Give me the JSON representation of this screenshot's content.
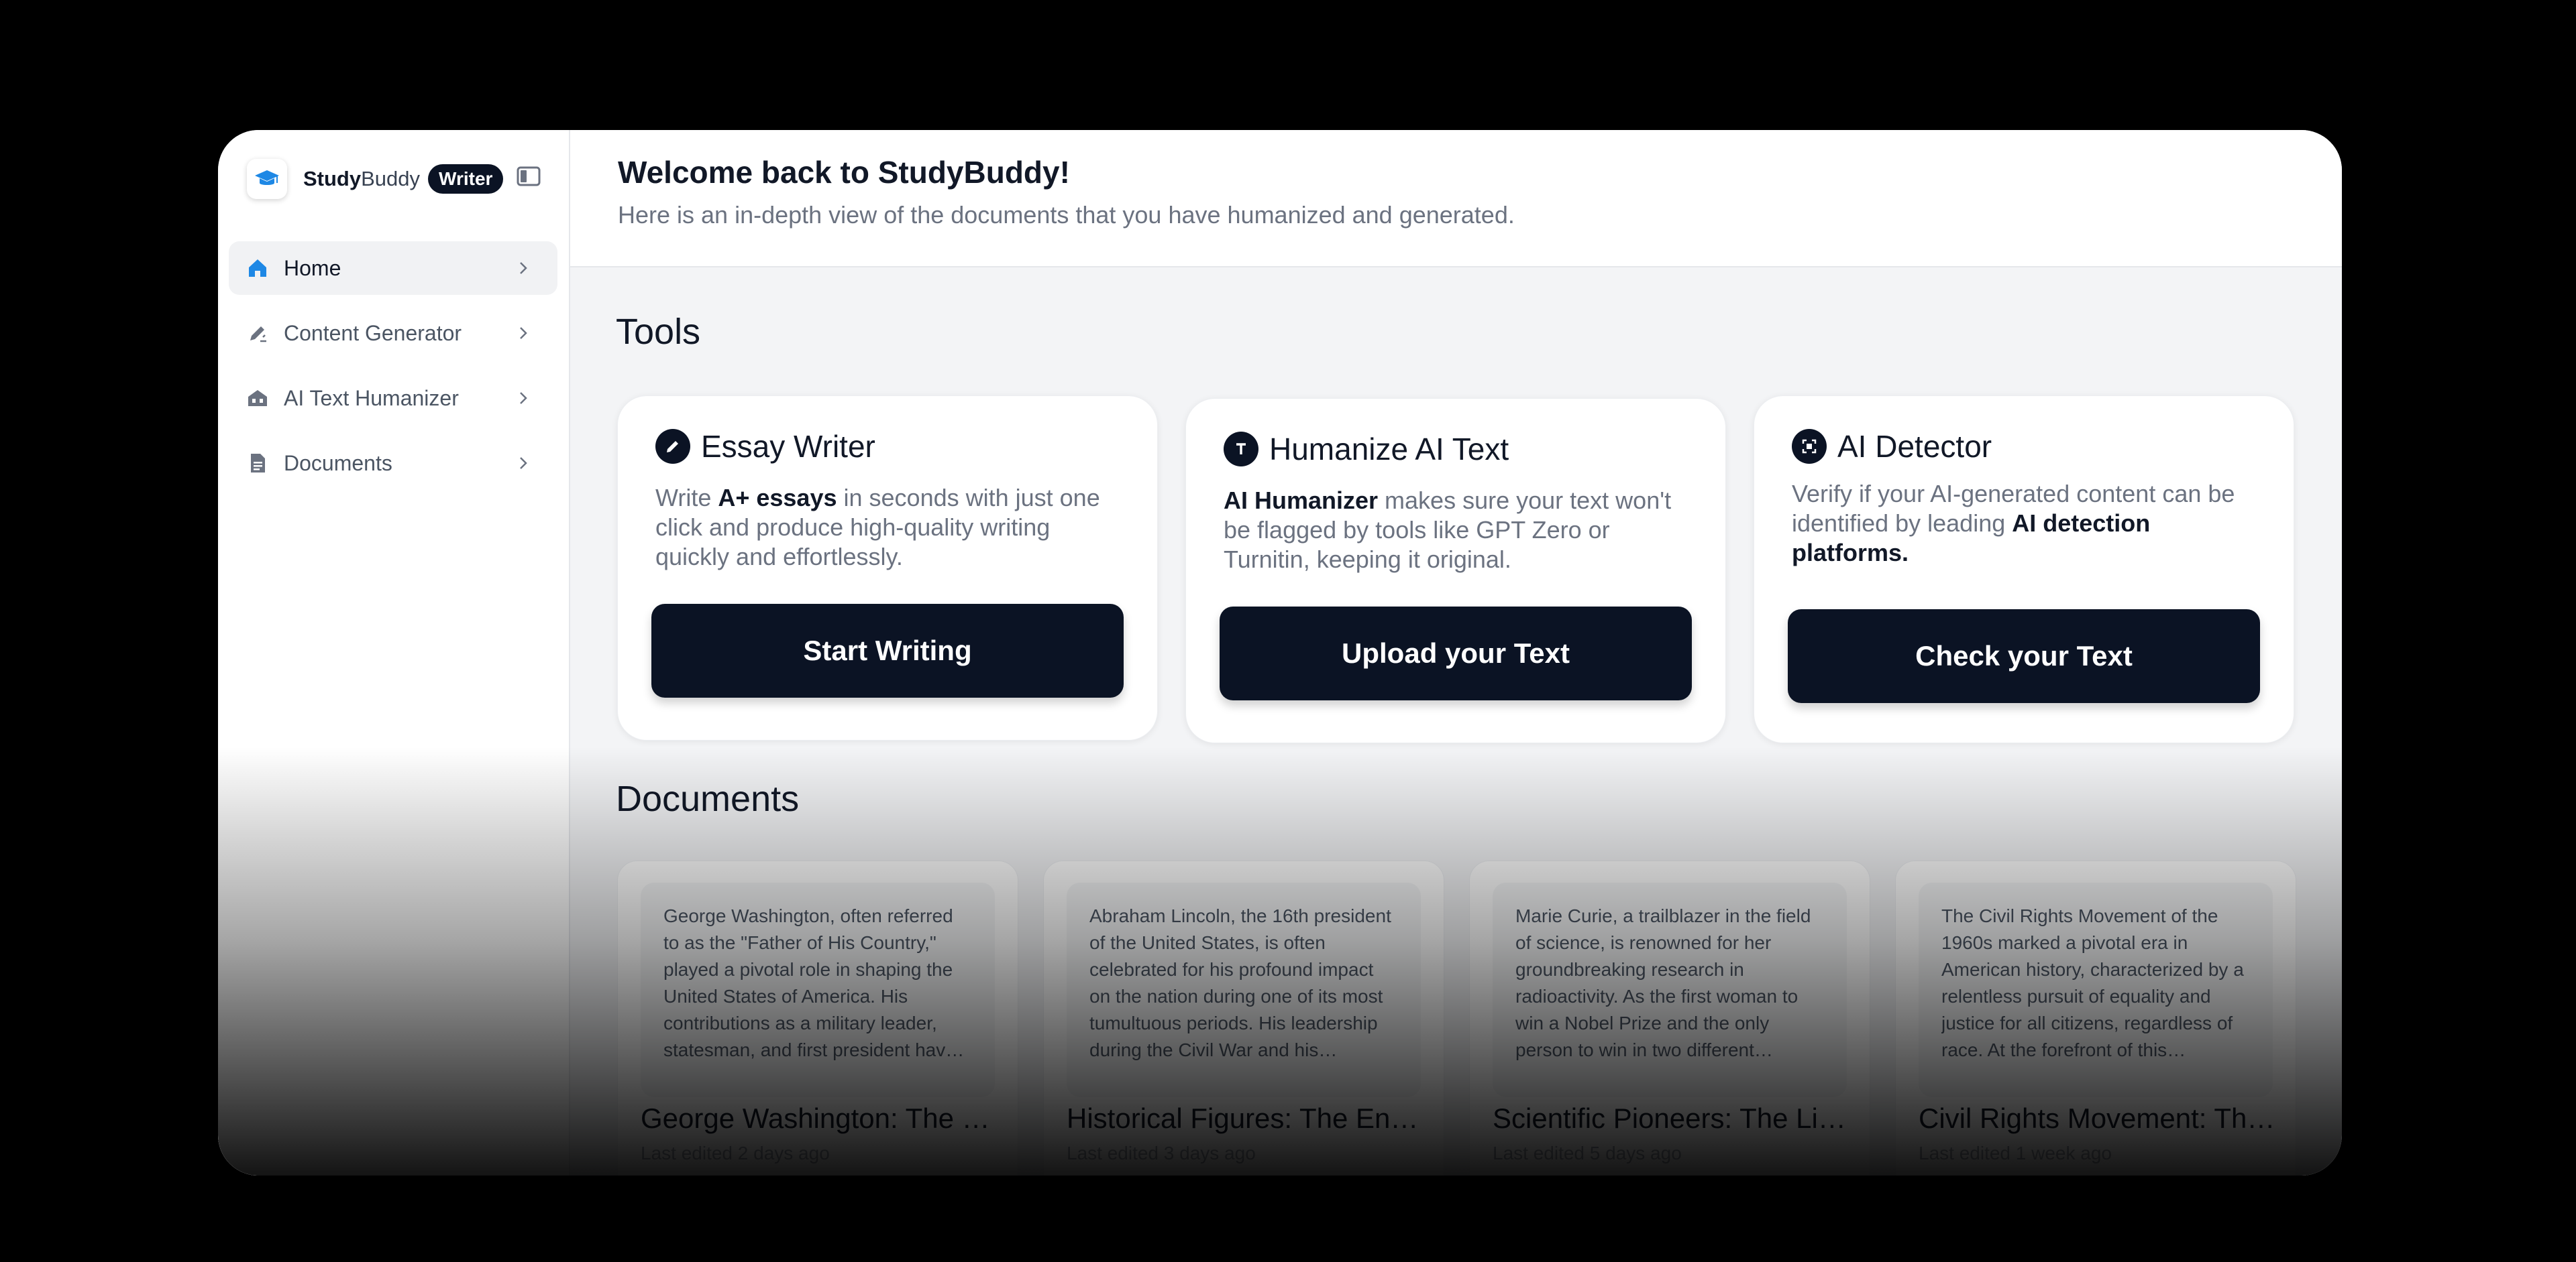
{
  "brand": {
    "name_bold": "Study",
    "name_light": "Buddy",
    "badge": "Writer"
  },
  "sidebar": {
    "items": [
      {
        "label": "Home",
        "icon": "home-icon",
        "active": true
      },
      {
        "label": "Content Generator",
        "icon": "pen-icon"
      },
      {
        "label": "AI Text Humanizer",
        "icon": "building-icon"
      },
      {
        "label": "Documents",
        "icon": "document-icon"
      }
    ]
  },
  "header": {
    "title": "Welcome back to StudyBuddy!",
    "subtitle": "Here is an in-depth view of the documents that you have humanized and generated."
  },
  "tools": {
    "section_title": "Tools",
    "cards": [
      {
        "title": "Essay Writer",
        "icon": "pen-icon",
        "desc_parts": [
          "Write ",
          "A+ essays",
          " in seconds with just one click and produce high-quality writing quickly and effortlessly."
        ],
        "button": "Start Writing"
      },
      {
        "title": "Humanize AI Text",
        "icon": "text-icon",
        "desc_parts": [
          "",
          "AI Humanizer",
          " makes sure your text won't be flagged by tools like GPT Zero or Turnitin, keeping it original."
        ],
        "button": "Upload your Text"
      },
      {
        "title": "AI Detector",
        "icon": "scan-icon",
        "desc_parts": [
          "Verify if your AI-generated content can be identified by leading ",
          "AI detection platforms.",
          ""
        ],
        "button": "Check your Text"
      }
    ]
  },
  "documents": {
    "section_title": "Documents",
    "items": [
      {
        "preview": "George Washington, often referred to as the \"Father of His Country,\" played a pivotal role in shaping the United States of America. His contributions as a military leader, statesman, and first president have left an enduring legacy.",
        "title": "George Washington: The Father of His Country",
        "meta": "Last edited 2 days ago"
      },
      {
        "preview": "Abraham Lincoln, the 16th president of the United States, is often celebrated for his profound impact on the nation during one of its most tumultuous periods. His leadership during the Civil War and his commitment to unity.",
        "title": "Historical Figures: The Enduring Legacy of Lincoln",
        "meta": "Last edited 3 days ago"
      },
      {
        "preview": "Marie Curie, a trailblazer in the field of science, is renowned for her groundbreaking research in radioactivity. As the first woman to win a Nobel Prize and the only person to win in two different sciences.",
        "title": "Scientific Pioneers: The Life of Marie Curie",
        "meta": "Last edited 5 days ago"
      },
      {
        "preview": "The Civil Rights Movement of the 1960s marked a pivotal era in American history, characterized by a relentless pursuit of equality and justice for all citizens, regardless of race. At the forefront of this movement stood many leaders.",
        "title": "Civil Rights Movement: The Fight for Equality",
        "meta": "Last edited 1 week ago"
      }
    ]
  }
}
